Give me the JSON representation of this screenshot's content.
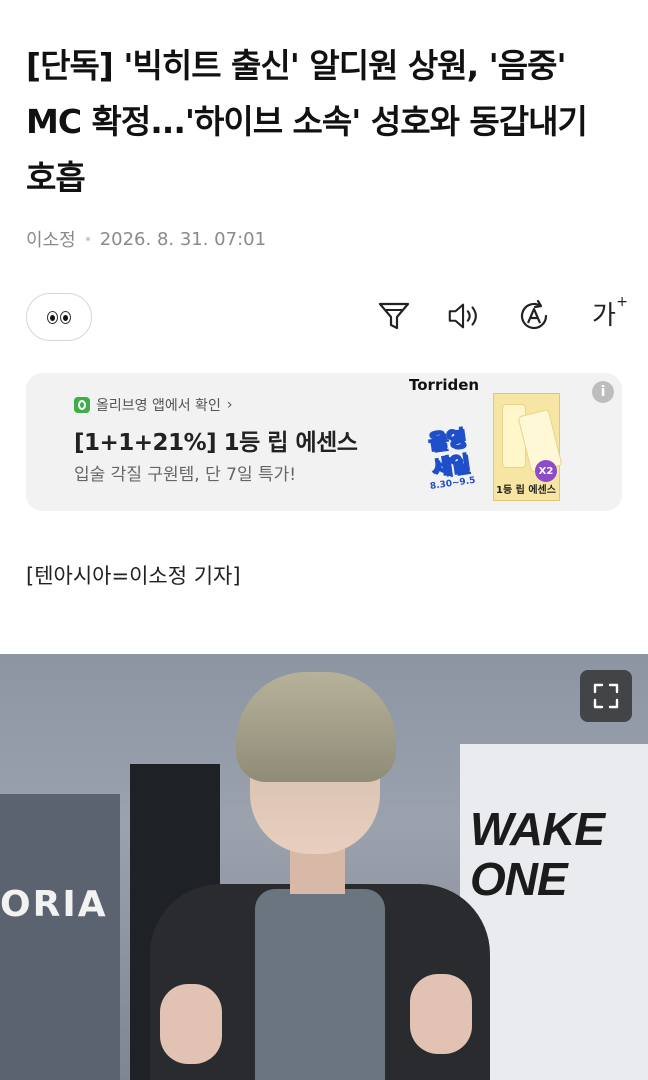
{
  "article": {
    "headline": "[단독] '빅히트 출신' 알디원 상원, '음중' MC 확정...'하이브 소속' 성호와 동갑내기 호흡",
    "author": "이소정",
    "datetime": "2026. 8. 31. 07:01",
    "byline": "[텐아시아=이소정 기자]"
  },
  "toolbar": {
    "reaction_icon": "eyes-emoji-icon",
    "filter_icon": "summary-filter-icon",
    "audio_icon": "speaker-icon",
    "translate_icon": "translate-a-icon",
    "font_size_label": "가",
    "font_size_plus": "+"
  },
  "ad": {
    "source": "올리브영 앱에서 확인",
    "source_chevron": "›",
    "title": "[1+1+21%] 1등 립 에센스",
    "description": "입술 각질 구원템, 단 7일 특가!",
    "brand": "Torriden",
    "sale_line1": "올영",
    "sale_line2": "세일",
    "sale_dates": "8.30~9.5",
    "product_multiplier": "X2",
    "product_label": "1등 립 에센스",
    "info_label": "i"
  },
  "photo": {
    "sign_text_1": "WAKE",
    "sign_text_2": "ONE",
    "sign_text_left": "ORIA",
    "expand_icon": "fullscreen-expand-icon"
  }
}
